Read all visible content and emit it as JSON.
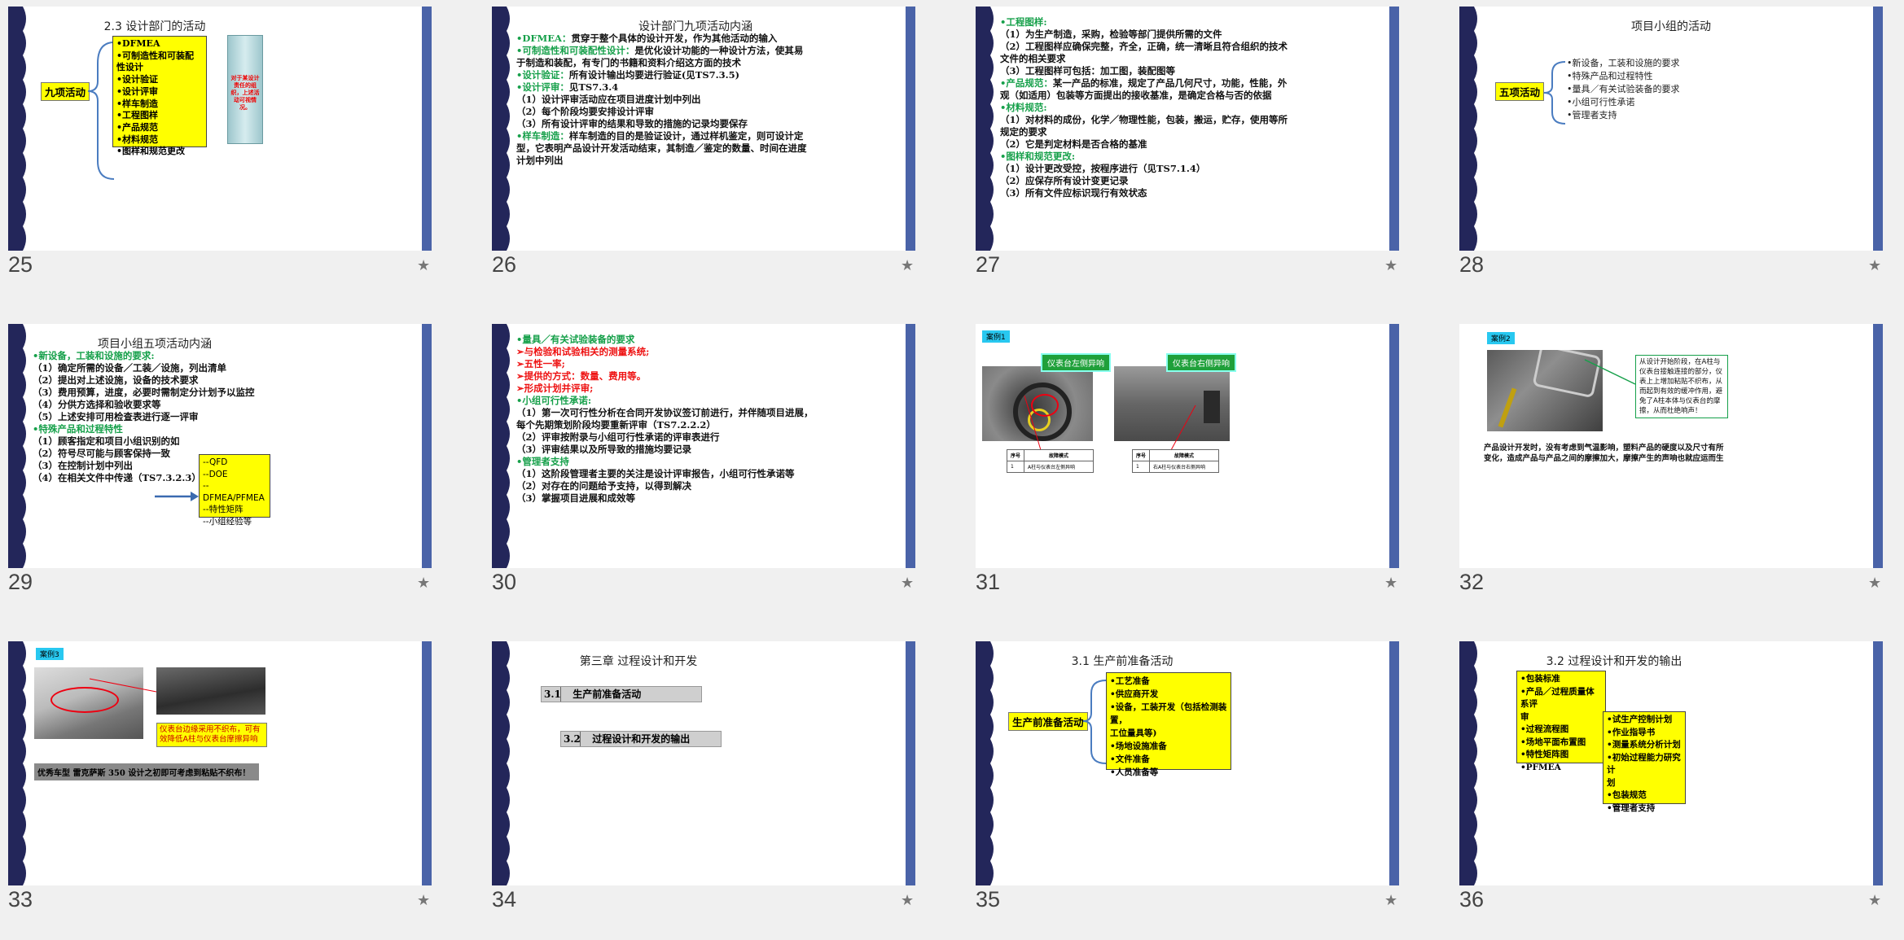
{
  "colors": {
    "accent_bar": "#4a63a8",
    "wave": "#23265a",
    "green_text": "#16a04a",
    "red_text": "#e11111",
    "highlight": "#ffff00",
    "case_tag": "#28c8f0"
  },
  "slides": [
    {
      "num": "25",
      "title": "2.3  设计部门的活动",
      "label": "九项活动",
      "items": [
        "•DFMEA",
        "•可制造性和可装配性设计",
        "•设计验证",
        "•设计评审",
        "•样车制造",
        "•工程图样",
        "•产品规范",
        "•材料规范",
        "•图样和规范更改"
      ],
      "note": "对于某设计责任的组织，上述活动可视情况。"
    },
    {
      "num": "26",
      "title": "设计部门九项活动内涵",
      "lines": [
        {
          "g": "•DFMEA：",
          "t": "贯穿于整个具体的设计开发，作为其他活动的输入"
        },
        {
          "g": "•可制造性和可装配性设计：",
          "t": "是优化设计功能的一种设计方法，使其易"
        },
        {
          "t": "于制造和装配，有专门的书籍和资料介绍这方面的技术"
        },
        {
          "g": "•设计验证：",
          "t": "所有设计输出均要进行验证(见TS7.3.5)"
        },
        {
          "g": "•设计评审：",
          "t": "见TS7.3.4"
        },
        {
          "t": "（1）设计评审活动应在项目进度计划中列出"
        },
        {
          "t": "（2）每个阶段均要安排设计评审"
        },
        {
          "t": "（3）所有设计评审的结果和导致的措施的记录均要保存"
        },
        {
          "g": "•样车制造：",
          "t": "样车制造的目的是验证设计，通过样机鉴定，则可设计定"
        },
        {
          "t": "型，它表明产品设计开发活动结束，其制造／鉴定的数量、时间在进度"
        },
        {
          "t": "计划中列出"
        }
      ]
    },
    {
      "num": "27",
      "lines": [
        {
          "g": "•工程图样:",
          "t": ""
        },
        {
          "t": "（1）为生产制造，采购，检验等部门提供所需的文件"
        },
        {
          "t": "（2）工程图样应确保完整，齐全，正确，统一清晰且符合组织的技术"
        },
        {
          "t": "文件的相关要求"
        },
        {
          "t": "（3）工程图样可包括：加工图，装配图等"
        },
        {
          "g": "•产品规范：",
          "t": "某一产品的标准，规定了产品几何尺寸，功能，性能，外"
        },
        {
          "t": "观（如适用）包装等方面提出的接收基准，是确定合格与否的依据"
        },
        {
          "g": "•材料规范:",
          "t": ""
        },
        {
          "t": "（1）对材料的成份，化学／物理性能，包装，搬运，贮存，使用等所"
        },
        {
          "t": "规定的要求"
        },
        {
          "t": "（2）它是判定材料是否合格的基准"
        },
        {
          "g": "•图样和规范更改:",
          "t": ""
        },
        {
          "t": "（1）设计更改受控，按程序进行（见TS7.1.4）"
        },
        {
          "t": "（2）应保存所有设计变更记录"
        },
        {
          "t": "（3）所有文件应标识现行有效状态"
        }
      ]
    },
    {
      "num": "28",
      "title": "项目小组的活动",
      "label": "五项活动",
      "items": [
        "•新设备，工装和设施的要求",
        "•特殊产品和过程特性",
        "•量具／有关试验装备的要求",
        "•小组可行性承诺",
        "•管理者支持"
      ]
    },
    {
      "num": "29",
      "title": "项目小组五项活动内涵",
      "lines": [
        {
          "g": "•新设备，工装和设施的要求:",
          "t": ""
        },
        {
          "t": "（1）确定所需的设备／工装／设施，列出清单"
        },
        {
          "t": "（2）提出对上述设施，设备的技术要求"
        },
        {
          "t": "（3）费用预算，进度，必要时需制定分计划予以监控"
        },
        {
          "t": "（4）分供方选择和验收要求等"
        },
        {
          "t": "（5）上述安排可用检查表进行逐一评审"
        },
        {
          "g": "•特殊产品和过程特性",
          "t": ""
        },
        {
          "t": "（1）顾客指定和项目小组识别的如"
        },
        {
          "t": "（2）符号尽可能与顾客保持一致"
        },
        {
          "t": "（3）在控制计划中列出"
        },
        {
          "t": "（4）在相关文件中传递（TS7.3.2.3）"
        }
      ],
      "box": [
        "--QFD",
        "--DOE",
        "--DFMEA/PFMEA",
        "--特性矩阵",
        "--小组经验等"
      ]
    },
    {
      "num": "30",
      "lines": [
        {
          "g": "•量具／有关试验装备的要求",
          "t": ""
        },
        {
          "r": "   ➢与检验和试验相关的测量系统;",
          "t": ""
        },
        {
          "r": "   ➢五性一率;",
          "t": ""
        },
        {
          "r": "   ➢提供的方式：数量、费用等。",
          "t": ""
        },
        {
          "r": "   ➢形成计划并评审;",
          "t": ""
        },
        {
          "g": "•小组可行性承诺:",
          "t": ""
        },
        {
          "t": "（1）第一次可行性分析在合同开发协议签订前进行，并伴随项目进展，"
        },
        {
          "t": "      每个先期策划阶段均要重新评审（TS7.2.2.2）"
        },
        {
          "t": "（2）评审按附录与小组可行性承诺的评审表进行"
        },
        {
          "t": "（3）评审结果以及所导致的措施均要记录"
        },
        {
          "g": "•管理者支持",
          "t": ""
        },
        {
          "t": "（1）这阶段管理者主要的关注是设计评审报告，小组可行性承诺等"
        },
        {
          "t": "（2）对存在的问题给予支持，以得到解决"
        },
        {
          "t": "（3）掌握项目进展和成效等"
        }
      ]
    },
    {
      "num": "31",
      "tag": "案例1",
      "photo1": "仪表台左侧异响",
      "photo2": "仪表台右侧异响",
      "table_head": [
        "序号",
        "故障模式"
      ],
      "row1": [
        "1",
        "A柱与仪表台左侧异响"
      ],
      "row2": [
        "1",
        "右A柱与仪表台右侧异响"
      ]
    },
    {
      "num": "32",
      "tag": "案例2",
      "callout": "从设计开始阶段，在A柱与仪表台接触连接的部分，仪表上上增加粘贴不织布，从而起到有效的缓冲作用，避免了A柱本体与仪表台的摩擦，从而杜绝响声！",
      "text": "        产品设计开发时，没有考虑到气温影响，塑料产品的硬度以及尺寸有所变化，造成产品与产品之间的摩擦加大，摩擦产生的声响也就应运而生"
    },
    {
      "num": "33",
      "tag": "案例3",
      "note": "仪表台边缘采用不织布，可有效降低A柱与仪表台摩擦异响",
      "banner": "优秀车型 雷克萨斯 350 设计之初即可考虑到粘贴不织布！"
    },
    {
      "num": "34",
      "title": "第三章  过程设计和开发",
      "sec1_num": "3.1",
      "sec1_text": "生产前准备活动",
      "sec2_num": "3.2",
      "sec2_text": "过程设计和开发的输出"
    },
    {
      "num": "35",
      "title": "3.1 生产前准备活动",
      "label": "生产前准备活动",
      "items": [
        "•工艺准备",
        "•供应商开发",
        "•设备，工装开发（包括检测装置，",
        "工位量具等)",
        "•场地设施准备",
        "•文件准备",
        "•人员准备等"
      ]
    },
    {
      "num": "36",
      "title": "3.2  过程设计和开发的输出",
      "left": [
        "•包装标准",
        "•产品／过程质量体系评",
        "审",
        "•过程流程图",
        "•场地平面布置图",
        "•特性矩阵图",
        "•PFMEA"
      ],
      "right": [
        "•试生产控制计划",
        "•作业指导书",
        "•测量系统分析计划",
        "•初始过程能力研究计",
        "划",
        "•包装规范",
        "•管理者支持"
      ]
    }
  ]
}
